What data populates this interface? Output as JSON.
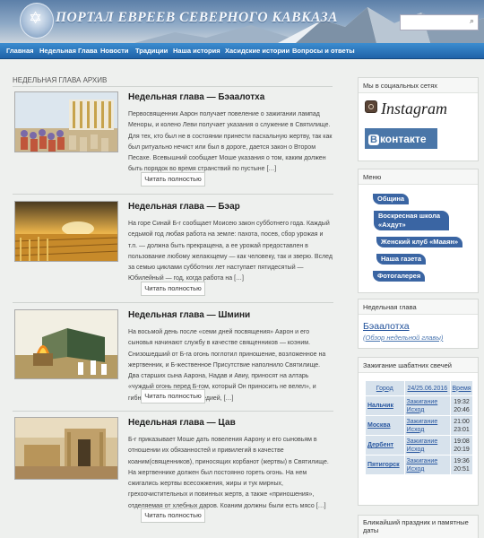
{
  "header": {
    "site_title": "ПОРТАЛ ЕВРЕЕВ СЕВЕРНОГО КАВКАЗА",
    "logo_icon": "star-of-david-icon",
    "search": {
      "placeholder": "",
      "icon": "search-icon",
      "glyph": "⌕"
    }
  },
  "nav": {
    "items": [
      "Главная",
      "Недельная Глава",
      "Новости",
      "Традиции",
      "Наша история",
      "Хасидские истории",
      "Вопросы и ответы"
    ]
  },
  "main": {
    "section_title": "НЕДЕЛЬНАЯ ГЛАВА АРХИВ",
    "read_more_label": "Читать полностью",
    "posts": [
      {
        "title": "Недельная глава — Бэаалотха",
        "text": "Первосвященник Аарон получает повеление о зажигании лампад Меноры, и колено Леви получает указания о служение в Святилище. Для тех, кто был не в состоянии принести пасхальную жертву, так как был ритуально нечист или был в дороге, дается закон о Втором Песахе. Всевышний сообщает Моше указания о том, каким должен быть порядок во время странствий по пустыне […]"
      },
      {
        "title": "Недельная глава — Бэар",
        "text": "На горе Синай Б-г сообщает Моисею закон субботнего года. Каждый седьмой год любая работа на земле: пахота, посев, сбор урожая и т.п. — должна быть прекращена, а ее урожай предоставлен в пользование любому желающему — как человеку, так и зверю. Вслед за семью циклами субботних лет наступает пятидесятый — Юбилейный — год, когда работа на […]"
      },
      {
        "title": "Недельная глава — Шмини",
        "text": "На восьмой день после «семи дней посвящения» Аарон и его сыновья начинают службу в качестве священников — коэним. Снизошедший от Б-га огонь поглотил приношение, возложенное на жертвенник, и Б-жественное Присутствие наполнило Святилище. Два старших сына Аарона, Надав и Авиу, приносят на алтарь «чуждый огонь перед Б-гом, который Он приносить не велел», и гибнут. Потрясенный трагедией, […]"
      },
      {
        "title": "Недельная глава — Цав",
        "text": "Б-г приказывает Моше дать повеления Аарону и его сыновьям в отношении их обязанностей и привилегий в качестве коаним(священников), приносящих корбанот (жертвы) в Святилище. На жертвеннике должен был постоянно гореть огонь. На нем сжигались жертвы всесожжения, жиры и тук мирных, грехоочистительных и повинных жертв, а также «приношения», отделяемая от хлебных даров. Коаним должны были есть мясо […]"
      }
    ]
  },
  "sidebar": {
    "social": {
      "title": "Мы в социальных сетях",
      "instagram_label": "Instagram",
      "instagram_icon": "instagram-icon",
      "vk_label": "контакте",
      "vk_badge": "В"
    },
    "menu": {
      "title": "Меню",
      "items": [
        "Община",
        "Воскресная школа «Ахдут»",
        "Женский клуб «Мааян»",
        "Наша газета",
        "Фотогалерея"
      ]
    },
    "parsha": {
      "title": "Недельная глава",
      "name": "Бэаалотха",
      "review_link": "(Обзор недельной главы)"
    },
    "candles": {
      "title": "Зажигание шабатних свечей",
      "headers": [
        "Город",
        "24/25.06.2016",
        "Время"
      ],
      "rows": [
        {
          "city": "Нальчик",
          "events": [
            "Зажигание",
            "Исход"
          ],
          "times": [
            "19:32",
            "20:46"
          ]
        },
        {
          "city": "Москва",
          "events": [
            "Зажигание",
            "Исход"
          ],
          "times": [
            "21:00",
            "23:01"
          ]
        },
        {
          "city": "Дербент",
          "events": [
            "Зажигание",
            "Исход"
          ],
          "times": [
            "19:08",
            "20:19"
          ]
        },
        {
          "city": "Пятигорск",
          "events": [
            "Зажигание",
            "Исход"
          ],
          "times": [
            "19:36",
            "20:51"
          ]
        }
      ]
    },
    "holidays": {
      "title": "Ближайший праздник и памятные даты"
    }
  },
  "colors": {
    "nav_blue": "#2a72bb",
    "link_blue": "#1e4f99",
    "menu_pill": "#3a65a3",
    "vk_blue": "#4a76a8"
  }
}
